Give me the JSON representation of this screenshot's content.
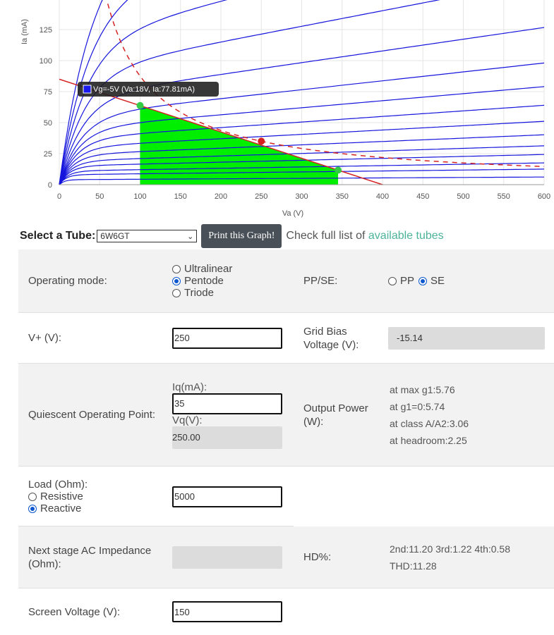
{
  "chart": {
    "xlabel": "Va (V)",
    "ylabel": "Ia (mA)",
    "xticks": [
      "0",
      "50",
      "100",
      "150",
      "200",
      "250",
      "300",
      "350",
      "400",
      "450",
      "500",
      "550",
      "600"
    ],
    "yticks": [
      "0",
      "25",
      "50",
      "75",
      "100",
      "125"
    ],
    "xlim": [
      0,
      600
    ],
    "ylim": [
      -5,
      150
    ],
    "tooltip": "Vg=-5V (Va:18V, Ia:77.81mA)",
    "load_line": {
      "va0": 0,
      "ia0": 85,
      "va1": 400,
      "ia1": 0
    },
    "operating_point": {
      "va": 250,
      "ia": 35
    },
    "swing_start": {
      "va": 100,
      "ia": 65
    },
    "swing_end": {
      "va": 345,
      "ia": 16
    },
    "curve_levels_mA": [
      4,
      8,
      11,
      15,
      19,
      24,
      30,
      37,
      45,
      55,
      70,
      90,
      115,
      145,
      180
    ],
    "colors": {
      "curves": "#1515dd",
      "load_line": "#d62424",
      "fill": "#00ee00",
      "op_point": "#d62020",
      "swing_points": "#33cc44"
    }
  },
  "selector": {
    "label": "Select a Tube:",
    "selected": "6W6GT",
    "print_button": "Print this Graph!",
    "check_prefix": "Check full list of",
    "check_link": "available tubes"
  },
  "settings": {
    "operating_mode": {
      "label": "Operating mode:",
      "options": [
        "Ultralinear",
        "Pentode",
        "Triode"
      ],
      "selected": "Pentode"
    },
    "pp_se": {
      "label": "PP/SE:",
      "options": [
        "PP",
        "SE"
      ],
      "selected": "SE"
    },
    "vplus": {
      "label": "V+ (V):",
      "value": "250"
    },
    "grid_bias": {
      "label": "Grid Bias Voltage (V):",
      "value": "-15.14"
    },
    "quiescent": {
      "label": "Quiescent Operating Point:",
      "iq_label": "Iq(mA):",
      "iq_value": "35",
      "vq_label": "Vq(V):",
      "vq_value": "250.00"
    },
    "output_power": {
      "label": "Output Power (W):",
      "lines": [
        "at max g1:5.76",
        "at g1=0:5.74",
        "at class A/A2:3.06",
        "at headroom:2.25"
      ]
    },
    "load": {
      "label": "Load (Ohm):",
      "options": [
        "Resistive",
        "Reactive"
      ],
      "selected": "Reactive",
      "value": "5000"
    },
    "next_stage": {
      "label": "Next stage AC Impedance (Ohm):",
      "value": ""
    },
    "hd": {
      "label": "HD%:",
      "line1": "2nd:11.20 3rd:1.22 4th:0.58",
      "line2": "THD:11.28"
    },
    "screen_voltage": {
      "label": "Screen Voltage (V):",
      "value": "150"
    }
  }
}
